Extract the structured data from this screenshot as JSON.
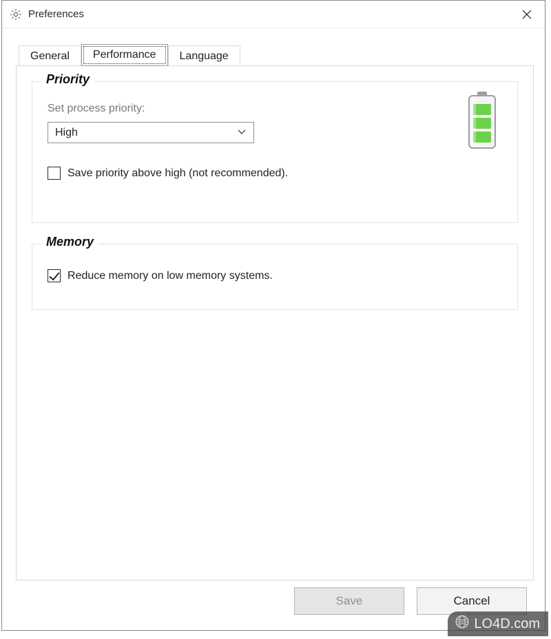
{
  "window": {
    "title": "Preferences"
  },
  "tabs": {
    "general": "General",
    "performance": "Performance",
    "language": "Language",
    "active": "performance"
  },
  "priority": {
    "group_title": "Priority",
    "label": "Set process priority:",
    "value": "High",
    "save_above_high_label": "Save priority above high (not recommended).",
    "save_above_high_checked": false
  },
  "memory": {
    "group_title": "Memory",
    "reduce_label": "Reduce memory on low memory systems.",
    "reduce_checked": true
  },
  "buttons": {
    "save": "Save",
    "cancel": "Cancel"
  },
  "watermark": {
    "text": "LO4D.com"
  },
  "icons": {
    "gear": "gear-icon",
    "close": "close-icon",
    "chevron_down": "chevron-down-icon",
    "battery": "battery-icon",
    "globe": "globe-icon"
  }
}
